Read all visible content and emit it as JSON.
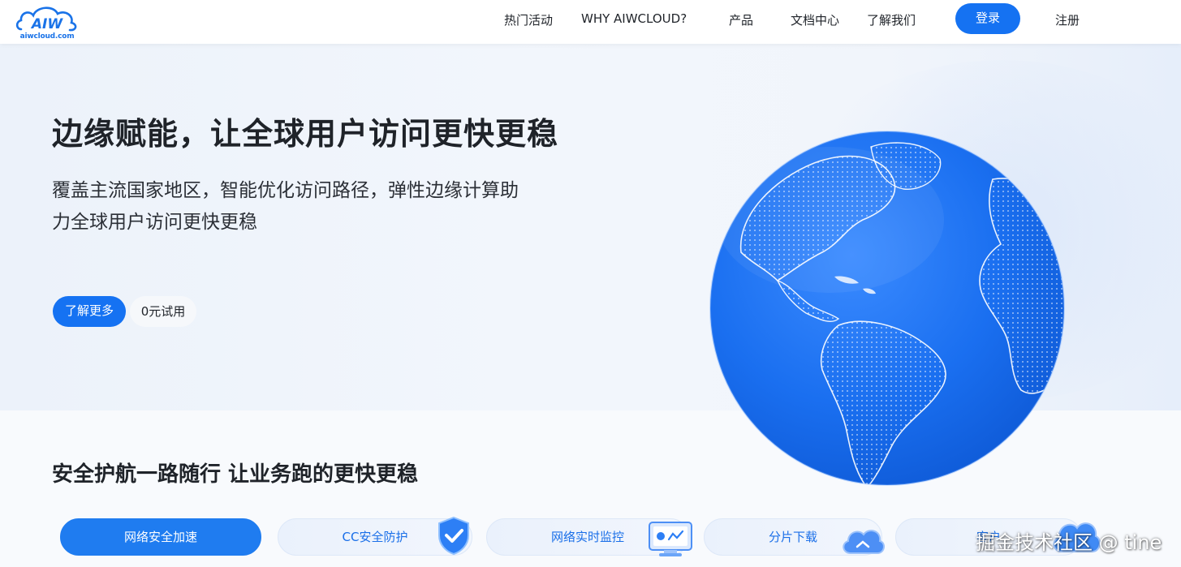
{
  "header": {
    "logo": {
      "mark": "AIW",
      "text": "aiwcloud.com"
    },
    "nav": [
      {
        "label": "热门活动"
      },
      {
        "label": "WHY AIWCLOUD?"
      },
      {
        "label": "产品"
      },
      {
        "label": "文档中心"
      },
      {
        "label": "了解我们"
      }
    ],
    "login_label": "登录",
    "register_label": "注册"
  },
  "hero": {
    "title": "边缘赋能，让全球用户访问更快更稳",
    "subtitle_line1": "覆盖主流国家地区，智能优化访问路径，弹性边缘计算助",
    "subtitle_line2": "力全球用户访问更快更稳",
    "primary_button": "了解更多",
    "secondary_button": "0元试用"
  },
  "section": {
    "title": "安全护航一路随行 让业务跑的更快更稳",
    "tabs": [
      {
        "label": "网络安全加速",
        "icon": "rocket-icon",
        "active": true
      },
      {
        "label": "CC安全防护",
        "icon": "shield-check-icon",
        "active": false
      },
      {
        "label": "网络实时监控",
        "icon": "monitor-icon",
        "active": false
      },
      {
        "label": "分片下载",
        "icon": "cloud-icon",
        "active": false
      },
      {
        "label": "客户",
        "icon": "cloud-icon",
        "active": false
      }
    ]
  },
  "watermark": "掘金技术社区 @ tine",
  "colors": {
    "brand_blue": "#1572f2",
    "globe_blue": "#1a6ff0",
    "text_dark": "#1f2329"
  }
}
